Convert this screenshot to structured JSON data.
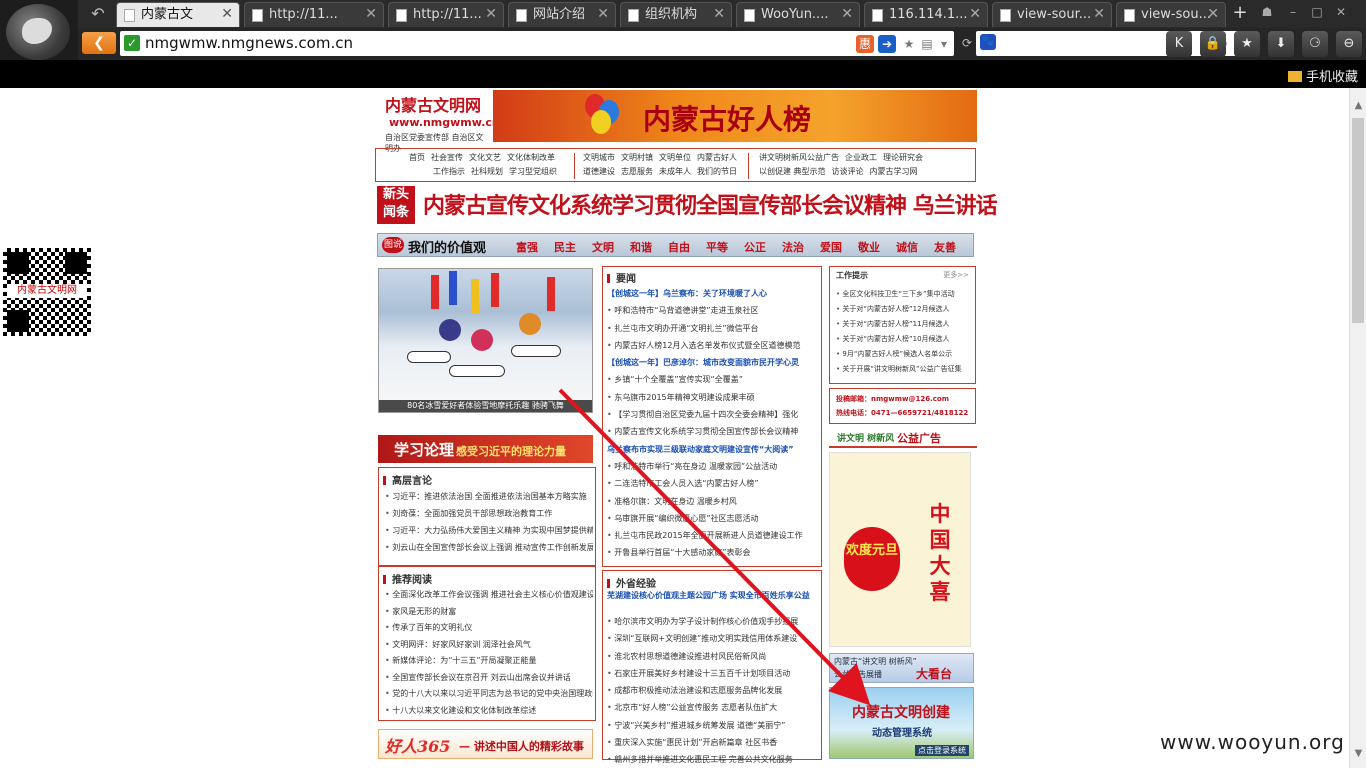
{
  "browser": {
    "tabs": [
      {
        "label": "内蒙古文",
        "active": true
      },
      {
        "label": "http://11...",
        "active": false
      },
      {
        "label": "http://11...",
        "active": false
      },
      {
        "label": "网站介绍",
        "active": false
      },
      {
        "label": "组织机构",
        "active": false
      },
      {
        "label": "WooYun....",
        "active": false
      },
      {
        "label": "116.114.1...",
        "active": false
      },
      {
        "label": "view-sour...",
        "active": false
      },
      {
        "label": "view-sou...",
        "active": false
      }
    ],
    "url": "nmgwmw.nmgnews.com.cn",
    "bookmark_folder": "手机收藏"
  },
  "qr": {
    "label": "内蒙古文明网"
  },
  "site": {
    "logo_title": "内蒙古文明网",
    "logo_url": "www.nmgwmw.cn",
    "logo_sub": "自治区党委宣传部 自治区文明办",
    "banner_title": "内蒙古好人榜",
    "nav_groups": [
      {
        "row1": [
          "首页",
          "社会宣传",
          "文化文艺",
          "文化体制改革"
        ],
        "row2": [
          "工作指示",
          "社科规划",
          "学习型党组织"
        ]
      },
      {
        "row1": [
          "文明城市",
          "文明村镇",
          "文明单位",
          "内蒙古好人"
        ],
        "row2": [
          "道德建设",
          "志愿服务",
          "未成年人",
          "我们的节日"
        ]
      },
      {
        "row1": [
          "讲文明树新风公益广告",
          "企业政工",
          "理论研究会"
        ],
        "row2": [
          "以创促建 典型示范",
          "访谈评论",
          "内蒙古学习网"
        ]
      }
    ],
    "headline_tag": "新头闻条",
    "headline": "内蒙古宣传文化系统学习贯彻全国宣传部长会议精神 乌兰讲话",
    "values_title": "我们的价值观",
    "values_icon": "图说",
    "values": [
      "富强",
      "民主",
      "文明",
      "和谐",
      "自由",
      "平等",
      "公正",
      "法治",
      "爱国",
      "敬业",
      "诚信",
      "友善"
    ],
    "photo_caption": "80名冰雪爱好者体验雪地摩托乐趣 驰骋飞舞",
    "study_title": "学习论理",
    "study_sub": "感受习近平的理论力量",
    "sections": {
      "gaoduan": {
        "title": "高层言论",
        "items": [
          "习近平：推进依法治国 全面推进依法治国基本方略实施",
          "刘奇葆：全面加强党员干部思想政治教育工作",
          "习近平：大力弘扬伟大爱国主义精神 为实现中国梦提供精神支柱",
          "刘云山在全国宣传部长会议上强调 推动宣传工作创新发展"
        ]
      },
      "tuijian": {
        "title": "推荐阅读",
        "items": [
          "全面深化改革工作会议强调 推进社会主义核心价值观建设",
          "家风是无形的财富",
          "传承了百年的文明礼仪",
          "文明网评：好家风好家训 润泽社会风气",
          "新媒体评论：为“十三五”开局凝聚正能量",
          "全国宣传部长会议在京召开 刘云山出席会议并讲话",
          "党的十八大以来以习近平同志为总书记的党中央治国理政新实践",
          "十八大以来文化建设和文化体制改革综述"
        ]
      },
      "yaowen": {
        "title": "要闻",
        "items": [
          {
            "t": "【创城这一年】乌兰察布：关了环境暖了人心",
            "hl": true
          },
          {
            "t": "呼和浩特市“马背道德讲堂”走进玉泉社区",
            "hl": false
          },
          {
            "t": "扎兰屯市文明办开通“文明扎兰”微信平台",
            "hl": false
          },
          {
            "t": "内蒙古好人榜12月入选名单发布仪式暨全区道德模范",
            "hl": false
          },
          {
            "t": "【创城这一年】巴彦淖尔：城市改变面貌市民开学心灵",
            "hl": true
          },
          {
            "t": "乡镇“十个全覆盖”宣传实现“全覆盖”",
            "hl": false
          },
          {
            "t": "东乌旗市2015年精神文明建设成果丰硕",
            "hl": false
          },
          {
            "t": "【学习贯彻自治区党委九届十四次全委会精神】强化",
            "hl": false
          },
          {
            "t": "内蒙古宣传文化系统学习贯彻全国宣传部长会议精神",
            "hl": false
          },
          {
            "t": "乌兰察布市实现三级联动家庭文明建设宣传“大阅读”",
            "hl": true
          },
          {
            "t": "呼和浩特市举行“亮在身边 温暖家园”公益活动",
            "hl": false
          },
          {
            "t": "二连浩特市工会人员入选“内蒙古好人榜”",
            "hl": false
          },
          {
            "t": "准格尔旗：文明在身边 温暖乡村风",
            "hl": false
          },
          {
            "t": "乌审旗开展“编织微愿心愿”社区志愿活动",
            "hl": false
          },
          {
            "t": "扎兰屯市民政2015年全面开展新进人员道德建设工作",
            "hl": false
          },
          {
            "t": "开鲁县举行首届“十大感动家庭”表彰会",
            "hl": false
          }
        ]
      },
      "waisheng": {
        "title": "外省经验",
        "lead": "芜湖建设核心价值观主题公园广场 实现全市百姓乐享公益",
        "items": [
          "哈尔滨市文明办为学子设计制作核心价值观手抄报展",
          "深圳“互联网+文明创建”推动文明实践信用体系建设",
          "淮北农村思想道德建设推进村风民俗新风尚",
          "石家庄开展美好乡村建设十三五百千计划项目活动",
          "成都市积极推动法治建设和志愿服务品牌化发展",
          "北京市“好人榜”公益宣传服务 志愿者队伍扩大",
          "宁波“兴美乡村”推进城乡统筹发展 道德“美丽宁”",
          "重庆深入实施“惠民计划”开启新篇章 社区书香",
          "赣州多措并举推进文化惠民工程 完善公共文化服务"
        ]
      },
      "gongzuo": {
        "title": "工作提示",
        "more": "更多>>",
        "items": [
          "全区文化科技卫生“三下乡”集中活动",
          "关于对“内蒙古好人榜”12月候选人",
          "关于对“内蒙古好人榜”11月候选人",
          "关于对“内蒙古好人榜”10月候选人",
          "9月“内蒙古好人榜”候选人名单公示",
          "关于开展“讲文明树新风”公益广告征集"
        ]
      }
    },
    "contact": {
      "email_label": "投稿邮箱：",
      "email": "nmgwmw@126.com",
      "phone_label": "热线电话：",
      "phone": "0471—6659721/4818122"
    },
    "ad": {
      "header_green": "讲文明 树新风",
      "header_red": "公益广告",
      "lantern": "欢度元旦",
      "poster_big": "中国大喜",
      "bar_line1": "内蒙古“讲文明 树新风”",
      "bar_line2": "公益广告展播",
      "bar_big": "大看台",
      "mgmt_title": "内蒙古文明创建",
      "mgmt_sub": "动态管理系统",
      "mgmt_link": "点击登录系统"
    }
  },
  "watermark": "www.wooyun.org",
  "colors": {
    "brand_red": "#c0101a",
    "arrow": "#e0141e"
  }
}
